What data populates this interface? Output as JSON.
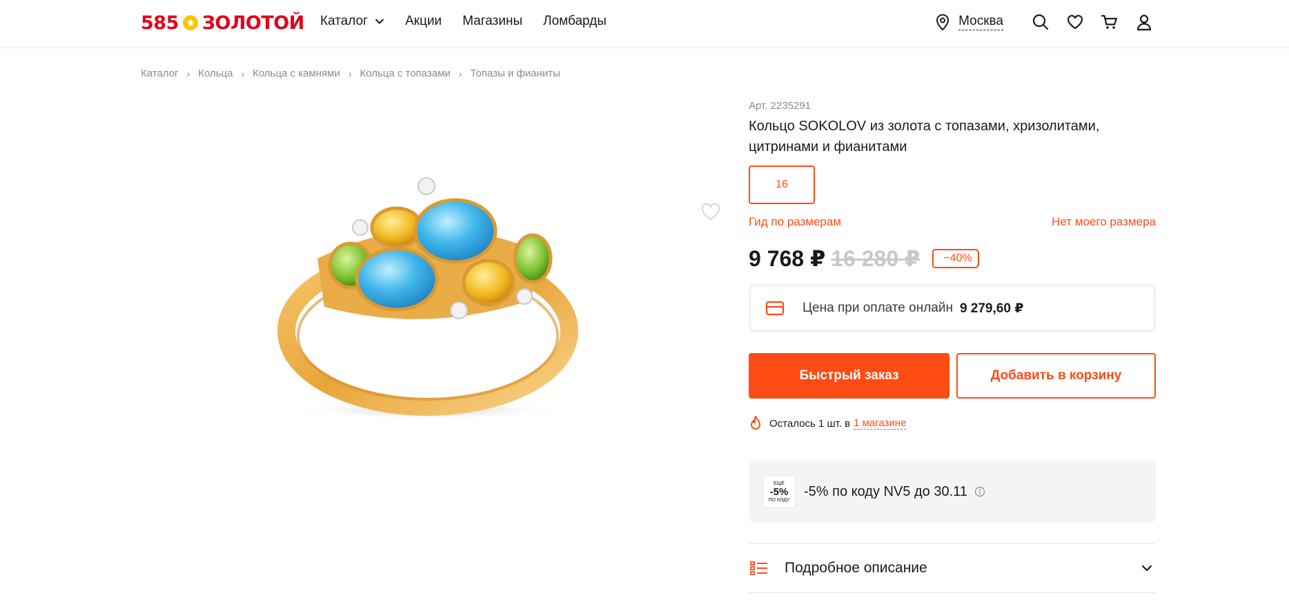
{
  "header": {
    "logo_number": "585",
    "logo_word": "ЗОЛОТОЙ",
    "nav": [
      "Каталог",
      "Акции",
      "Магазины",
      "Ломбарды"
    ],
    "city": "Москва",
    "icons": [
      "location-pin-icon",
      "search-icon",
      "heart-icon",
      "cart-icon",
      "user-icon"
    ]
  },
  "breadcrumb": [
    "Каталог",
    "Кольца",
    "Кольца с камнями",
    "Кольца с топазами",
    "Топазы и фианиты"
  ],
  "product": {
    "article": "Арт. 2235291",
    "title": "Кольцо SOKOLOV из золота с топазами, хризолитами, цитринами и фианитами",
    "size": "16",
    "size_guide": "Гид по размерам",
    "no_size": "Нет моего размера",
    "price": "9 768 ₽",
    "old_price": "16 280 ₽",
    "discount": "−40%",
    "online_label": "Цена при оплате онлайн",
    "online_price": "9 279,60 ₽",
    "quick_order": "Быстрый заказ",
    "add_to_cart": "Добавить в корзину",
    "stock_text": "Осталось 1 шт. в",
    "stock_link": "1 магазине",
    "promo_badge_top": "ЕЩЁ",
    "promo_badge_mid": "-5%",
    "promo_badge_bot": "ПО КОДУ",
    "promo_text": "-5% по коду NV5 до 30.11",
    "description": "Подробное описание"
  },
  "colors": {
    "accent": "#ff4b14",
    "logo_red": "#e3001b",
    "logo_star": "#ffc400"
  }
}
